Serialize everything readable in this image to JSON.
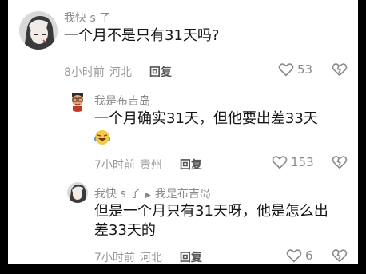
{
  "comments": [
    {
      "username": "我快 s 了",
      "text": "一个月不是只有31天吗?",
      "time": "8小时前",
      "location": "河北",
      "reply_label": "回复",
      "likes": "53"
    },
    {
      "username": "我是布吉岛",
      "text": "一个月确实31天，但他要出差33天",
      "time": "7小时前",
      "location": "贵州",
      "reply_label": "回复",
      "likes": "153"
    },
    {
      "username": "我快 s 了",
      "reply_to": "我是布吉岛",
      "text_line1": "但是一个月只有31天呀，他是怎么出",
      "text_line2": "差33天的",
      "time": "7小时前",
      "location": "河北",
      "reply_label": "回复",
      "likes": "6"
    }
  ],
  "colors": {
    "background": "#ffffff",
    "text": "#161616",
    "muted": "#8a8a8a"
  },
  "icons": [
    "heart-icon",
    "broken-heart-icon",
    "reply-arrow-icon",
    "laughing-crying-emoji"
  ]
}
